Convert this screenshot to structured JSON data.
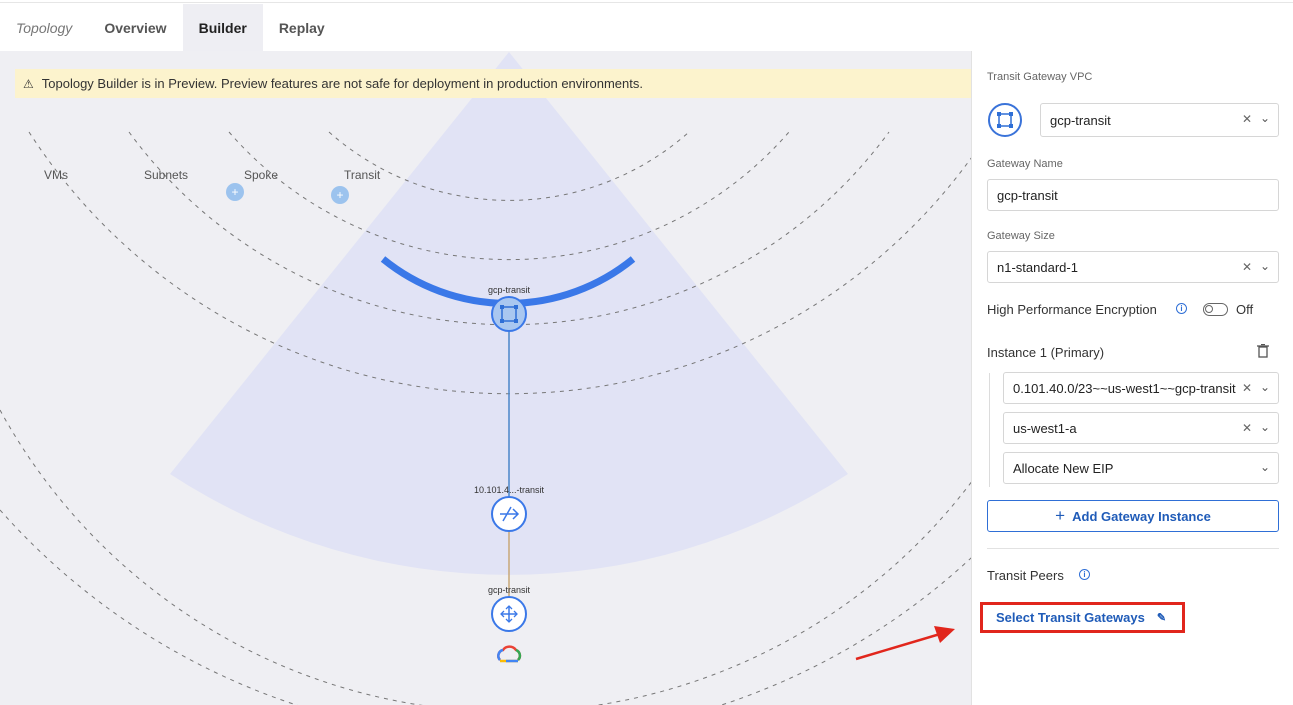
{
  "tabs": [
    {
      "label": "Topology"
    },
    {
      "label": "Overview"
    },
    {
      "label": "Builder"
    },
    {
      "label": "Replay"
    }
  ],
  "banner": {
    "text": "Topology Builder is in Preview. Preview features are not safe for deployment in production environments."
  },
  "rings": {
    "labels": [
      "VMs",
      "Subnets",
      "Spoke",
      "Transit"
    ]
  },
  "nodes": {
    "transit_gw": "gcp-transit",
    "instance": "10.101.4...-transit",
    "cloud": "gcp-transit"
  },
  "panel": {
    "vpc_label": "Transit Gateway VPC",
    "vpc_value": "gcp-transit",
    "gw_name_label": "Gateway Name",
    "gw_name_value": "gcp-transit",
    "gw_size_label": "Gateway Size",
    "gw_size_value": "n1-standard-1",
    "hpe_label": "High Performance Encryption",
    "hpe_state": "Off",
    "instance_label": "Instance 1 (Primary)",
    "subnet_value": "0.101.40.0/23~~us-west1~~gcp-transit",
    "zone_value": "us-west1-a",
    "eip_value": "Allocate New EIP",
    "add_instance_label": "Add Gateway Instance",
    "peers_label": "Transit Peers",
    "select_transit_label": "Select Transit Gateways"
  },
  "colors": {
    "accent": "#3a78e8",
    "highlight": "#e1261c",
    "warning_bg": "#fcf3cd",
    "sector_fill": "#e0e3f5"
  }
}
